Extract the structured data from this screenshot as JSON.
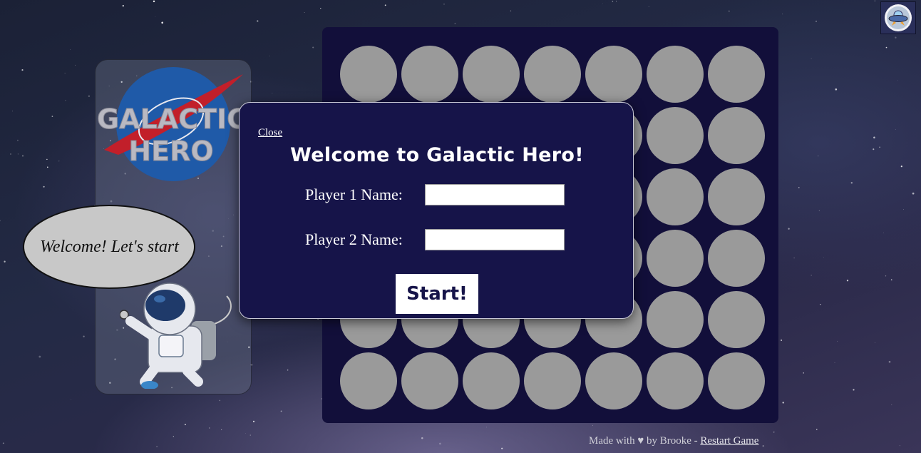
{
  "logo": {
    "line1": "GALACTIC",
    "line2": "HERO"
  },
  "speech_bubble": {
    "text": "Welcome! Let's start"
  },
  "board": {
    "rows": 6,
    "columns": 7,
    "cell_color": "#9a9a9a",
    "background_color": "#120f3a"
  },
  "modal": {
    "close_label": "Close",
    "title": "Welcome to Galactic Hero!",
    "player1_label": "Player 1 Name:",
    "player1_value": "",
    "player2_label": "Player 2 Name:",
    "player2_value": "",
    "start_label": "Start!",
    "background_color": "#161449"
  },
  "corner_badge": {
    "icon": "ufo-icon"
  },
  "footer": {
    "made_with": "Made with",
    "heart": "♥",
    "by": "by Brooke -",
    "restart_label": "Restart Game"
  }
}
